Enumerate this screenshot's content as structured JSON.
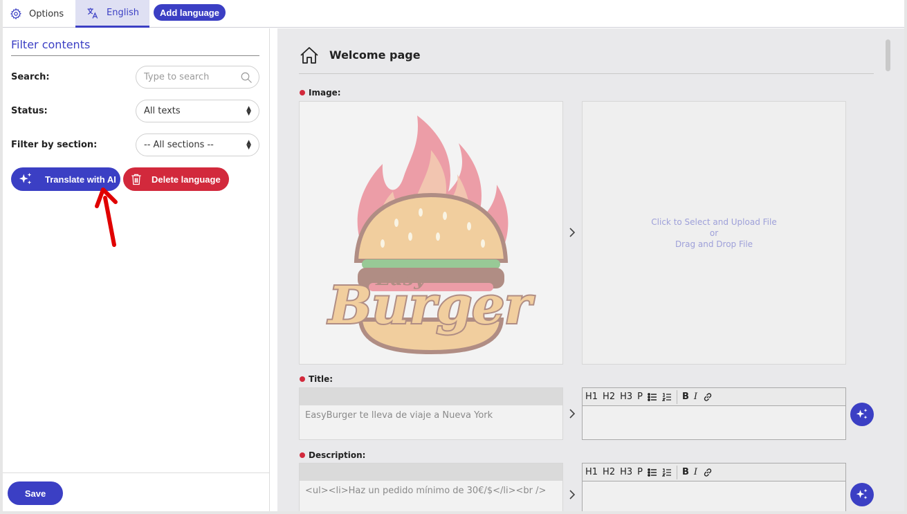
{
  "tabs": {
    "options_label": "Options",
    "english_label": "English",
    "add_language_label": "Add language"
  },
  "filter": {
    "title": "Filter contents",
    "search_label": "Search:",
    "search_placeholder": "Type to search",
    "status_label": "Status:",
    "status_value": "All texts",
    "section_label": "Filter by section:",
    "section_value": "-- All sections --",
    "translate_label": "Translate with AI",
    "delete_label": "Delete language",
    "save_label": "Save"
  },
  "page": {
    "title": "Welcome page",
    "image_label": "Image:",
    "upload_line1": "Click to Select and Upload File",
    "upload_line2": "or",
    "upload_line3": "Drag and Drop File",
    "logo_text_small": "Easy",
    "logo_text_big": "Burger",
    "title_label": "Title:",
    "title_source": "EasyBurger te lleva de viaje a Nueva York",
    "description_label": "Description:",
    "description_source": "<ul><li>Haz un pedido mínimo de 30€/$</li><br />"
  },
  "toolbar": {
    "h1": "H1",
    "h2": "H2",
    "h3": "H3",
    "p": "P",
    "bold": "B",
    "italic": "I"
  },
  "colors": {
    "accent": "#3b3fc4",
    "danger": "#d2293c",
    "annotation_arrow": "#e00000"
  },
  "icons": [
    "gear-icon",
    "translate-icon",
    "search-icon",
    "sparkles-icon",
    "trash-icon",
    "home-icon",
    "chevron-right-icon",
    "bullet-list-icon",
    "numbered-list-icon",
    "link-icon"
  ]
}
